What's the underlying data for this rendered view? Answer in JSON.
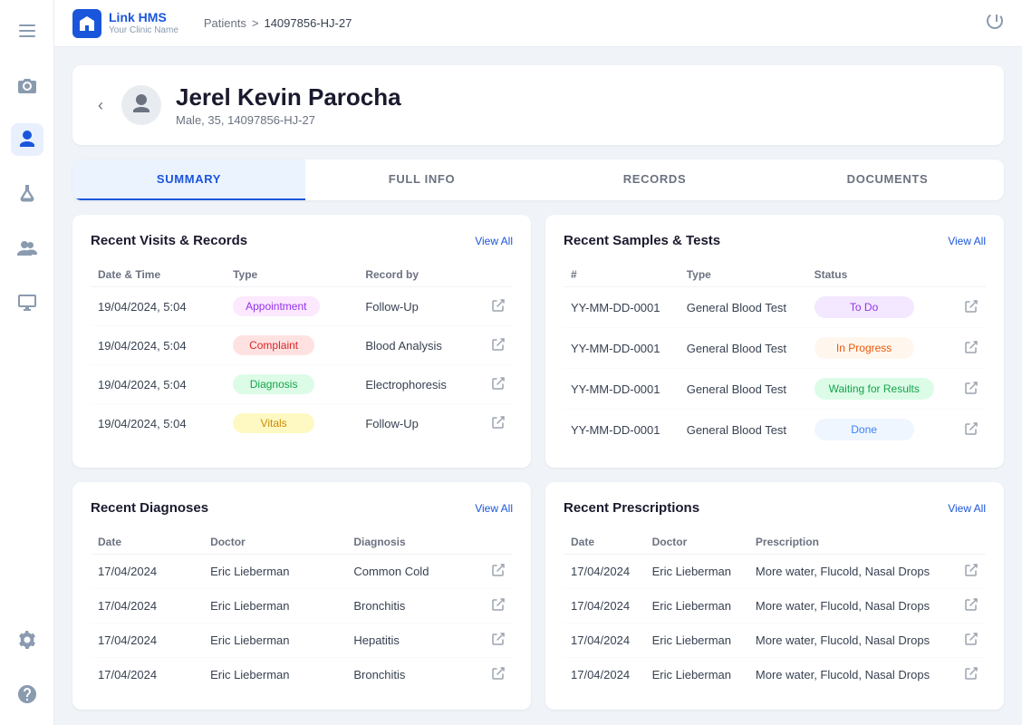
{
  "app": {
    "name": "Link HMS",
    "clinic": "Your Clinic Name"
  },
  "topnav": {
    "breadcrumb_patients": "Patients",
    "breadcrumb_sep": ">",
    "breadcrumb_current": "14097856-HJ-27"
  },
  "sidebar": {
    "icons": [
      {
        "name": "menu-icon",
        "symbol": "☰",
        "active": false
      },
      {
        "name": "camera-icon",
        "symbol": "📷",
        "active": false
      },
      {
        "name": "user-icon",
        "symbol": "👤",
        "active": true
      },
      {
        "name": "flask-icon",
        "symbol": "🧪",
        "active": false
      },
      {
        "name": "group-icon",
        "symbol": "👥",
        "active": false
      },
      {
        "name": "monitor-icon",
        "symbol": "🖥",
        "active": false
      },
      {
        "name": "settings-icon",
        "symbol": "⚙",
        "active": false
      },
      {
        "name": "help-icon",
        "symbol": "❓",
        "active": false
      }
    ]
  },
  "patient": {
    "name": "Jerel Kevin Parocha",
    "meta": "Male, 35, 14097856-HJ-27"
  },
  "tabs": [
    {
      "label": "SUMMARY",
      "active": true
    },
    {
      "label": "FULL INFO",
      "active": false
    },
    {
      "label": "RECORDS",
      "active": false
    },
    {
      "label": "DOCUMENTS",
      "active": false
    }
  ],
  "recent_visits": {
    "title": "Recent Visits & Records",
    "view_all": "View All",
    "columns": [
      "Date & Time",
      "Type",
      "Record by"
    ],
    "rows": [
      {
        "date": "19/04/2024, 5:04",
        "type": "Appointment",
        "type_class": "badge-appointment",
        "record_by": "Follow-Up"
      },
      {
        "date": "19/04/2024, 5:04",
        "type": "Complaint",
        "type_class": "badge-complaint",
        "record_by": "Blood Analysis"
      },
      {
        "date": "19/04/2024, 5:04",
        "type": "Diagnosis",
        "type_class": "badge-diagnosis",
        "record_by": "Electrophoresis"
      },
      {
        "date": "19/04/2024, 5:04",
        "type": "Vitals",
        "type_class": "badge-vitals",
        "record_by": "Follow-Up"
      }
    ]
  },
  "recent_samples": {
    "title": "Recent Samples & Tests",
    "view_all": "View All",
    "columns": [
      "#",
      "Type",
      "Status"
    ],
    "rows": [
      {
        "id": "YY-MM-DD-0001",
        "type": "General Blood Test",
        "status": "To Do",
        "status_class": "status-todo"
      },
      {
        "id": "YY-MM-DD-0001",
        "type": "General Blood Test",
        "status": "In Progress",
        "status_class": "status-inprogress"
      },
      {
        "id": "YY-MM-DD-0001",
        "type": "General Blood Test",
        "status": "Waiting for Results",
        "status_class": "status-waiting"
      },
      {
        "id": "YY-MM-DD-0001",
        "type": "General Blood Test",
        "status": "Done",
        "status_class": "status-done"
      }
    ]
  },
  "recent_diagnoses": {
    "title": "Recent Diagnoses",
    "view_all": "View All",
    "columns": [
      "Date",
      "Doctor",
      "Diagnosis"
    ],
    "rows": [
      {
        "date": "17/04/2024",
        "doctor": "Eric Lieberman",
        "diagnosis": "Common Cold"
      },
      {
        "date": "17/04/2024",
        "doctor": "Eric Lieberman",
        "diagnosis": "Bronchitis"
      },
      {
        "date": "17/04/2024",
        "doctor": "Eric Lieberman",
        "diagnosis": "Hepatitis"
      },
      {
        "date": "17/04/2024",
        "doctor": "Eric Lieberman",
        "diagnosis": "Bronchitis"
      }
    ]
  },
  "recent_prescriptions": {
    "title": "Recent Prescriptions",
    "view_all": "View All",
    "columns": [
      "Date",
      "Doctor",
      "Prescription"
    ],
    "rows": [
      {
        "date": "17/04/2024",
        "doctor": "Eric Lieberman",
        "prescription": "More water, Flucold, Nasal Drops"
      },
      {
        "date": "17/04/2024",
        "doctor": "Eric Lieberman",
        "prescription": "More water, Flucold, Nasal Drops"
      },
      {
        "date": "17/04/2024",
        "doctor": "Eric Lieberman",
        "prescription": "More water, Flucold, Nasal Drops"
      },
      {
        "date": "17/04/2024",
        "doctor": "Eric Lieberman",
        "prescription": "More water, Flucold, Nasal Drops"
      }
    ]
  }
}
